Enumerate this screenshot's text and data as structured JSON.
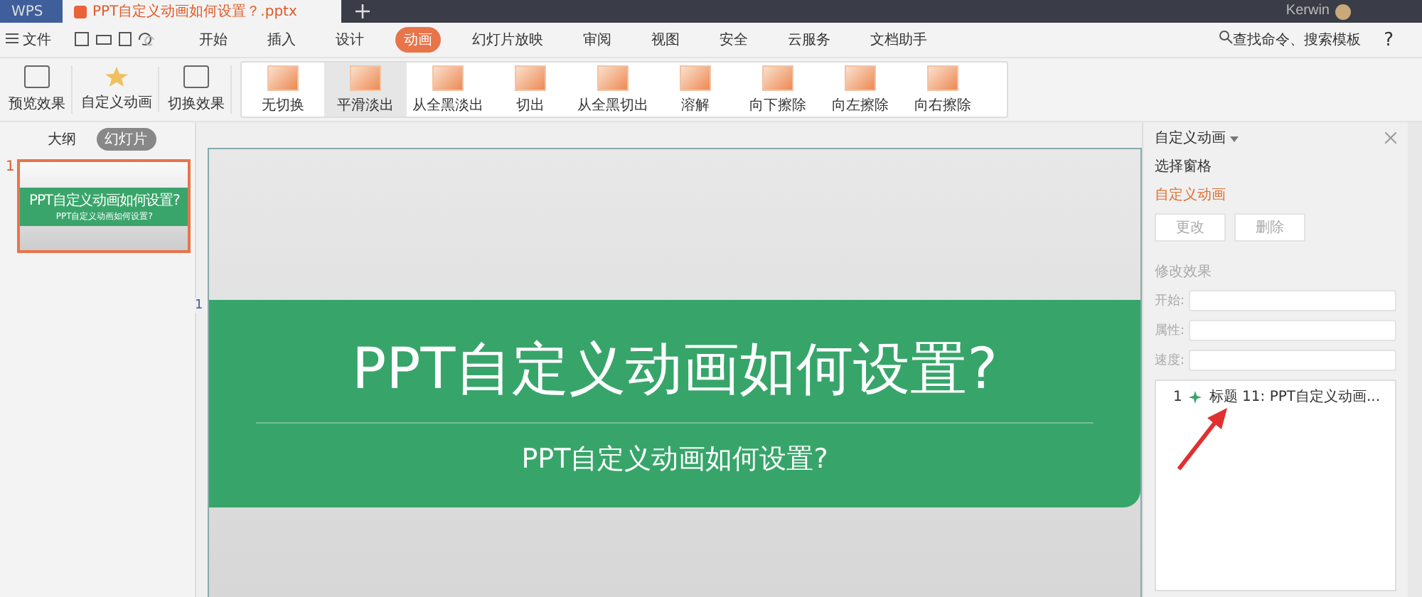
{
  "tabs": [
    {
      "label": "WPS",
      "selected": false
    },
    {
      "label": "PPT自定义动画如何设置？.pptx",
      "selected": true
    }
  ],
  "user": {
    "name": "Kerwin"
  },
  "menu": {
    "file": "文件",
    "items": [
      {
        "label": "开始",
        "selected": false
      },
      {
        "label": "插入",
        "selected": false
      },
      {
        "label": "设计",
        "selected": false
      },
      {
        "label": "动画",
        "selected": true
      },
      {
        "label": "幻灯片放映",
        "selected": false
      },
      {
        "label": "审阅",
        "selected": false
      },
      {
        "label": "视图",
        "selected": false
      },
      {
        "label": "安全",
        "selected": false
      },
      {
        "label": "云服务",
        "selected": false
      },
      {
        "label": "文档助手",
        "selected": false
      }
    ],
    "search": "查找命令、搜索模板",
    "help": "?"
  },
  "ribbon": {
    "tools": [
      {
        "label": "预览效果",
        "kind": "preview"
      },
      {
        "label": "自定义动画",
        "kind": "star"
      },
      {
        "label": "切换效果",
        "kind": "switch"
      }
    ],
    "transitions": [
      {
        "label": "无切换",
        "selected": false
      },
      {
        "label": "平滑淡出",
        "selected": true
      },
      {
        "label": "从全黑淡出",
        "selected": false
      },
      {
        "label": "切出",
        "selected": false
      },
      {
        "label": "从全黑切出",
        "selected": false
      },
      {
        "label": "溶解",
        "selected": false
      },
      {
        "label": "向下擦除",
        "selected": false
      },
      {
        "label": "向左擦除",
        "selected": false
      },
      {
        "label": "向右擦除",
        "selected": false
      }
    ]
  },
  "left_panel": {
    "views": [
      {
        "label": "大纲",
        "selected": false
      },
      {
        "label": "幻灯片",
        "selected": true
      }
    ],
    "slides": [
      {
        "number": "1",
        "selected": true,
        "title": "PPT自定义动画如何设置?",
        "subtitle": "PPT自定义动画如何设置?"
      }
    ]
  },
  "slide": {
    "marker": "1",
    "title": "PPT自定义动画如何设置?",
    "subtitle": "PPT自定义动画如何设置?"
  },
  "right_panel": {
    "title": "自定义动画",
    "select_pane": "选择窗格",
    "section": "自定义动画",
    "buttons": [
      {
        "label": "更改",
        "disabled": true
      },
      {
        "label": "删除",
        "disabled": true
      }
    ],
    "modify": "修改效果",
    "fields": [
      {
        "label": "开始:"
      },
      {
        "label": "属性:"
      },
      {
        "label": "速度:"
      }
    ],
    "animations": [
      {
        "number": "1",
        "label": "标题 11: PPT自定义动画..."
      }
    ]
  }
}
